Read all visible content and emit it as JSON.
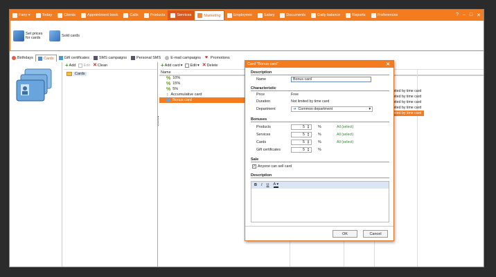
{
  "topbar": {
    "items": [
      {
        "label": "Fany ▾",
        "cls": ""
      },
      {
        "label": "Today",
        "cls": ""
      },
      {
        "label": "Clients",
        "cls": ""
      },
      {
        "label": "Appointment book",
        "cls": ""
      },
      {
        "label": "Calls",
        "cls": ""
      },
      {
        "label": "Products",
        "cls": ""
      },
      {
        "label": "Services",
        "cls": "sel"
      },
      {
        "label": "Marketing",
        "cls": "active"
      },
      {
        "label": "Employees",
        "cls": ""
      },
      {
        "label": "Salary",
        "cls": ""
      },
      {
        "label": "Documents",
        "cls": ""
      },
      {
        "label": "Daily balance",
        "cls": ""
      },
      {
        "label": "Reports",
        "cls": ""
      },
      {
        "label": "Preferences",
        "cls": ""
      }
    ],
    "win_controls": [
      "?",
      "–",
      "□",
      "✕"
    ]
  },
  "ribbon": {
    "set_prices": "Set prices for cards",
    "sold_cards": "Sold cards"
  },
  "tabs": [
    "Birthdays",
    "Cards",
    "Gift certificates",
    "SMS campaigns",
    "Personal SMS",
    "E-mail campaigns",
    "Promotions"
  ],
  "left_toolbar": {
    "add": "Add",
    "edit": "Edit",
    "clean": "Clean"
  },
  "tree": {
    "root": "Cards"
  },
  "right_toolbar": {
    "add_card": "Add card",
    "edit": "Edit",
    "delete": "Delete"
  },
  "list": {
    "header": "Name",
    "items": [
      "10%",
      "15%",
      "5%",
      "Accumulative card",
      "Bonus card"
    ]
  },
  "duration_cells": [
    "Not limited by time card",
    "Not limited by time card",
    "Not limited by time card",
    "Not limited by time card",
    "Not limited by time card"
  ],
  "dialog": {
    "title": "Card \"Bonus card\"",
    "description_section": "Description",
    "name_label": "Name",
    "name_value": "Bonus card",
    "characteristic_section": "Characteristic",
    "price_label": "Price",
    "price_value": "Free",
    "duration_label": "Duration",
    "duration_value": "Not limited by time card",
    "department_label": "Department",
    "department_value": "Common department",
    "bonuses_section": "Bonuses",
    "bonuses": [
      {
        "label": "Products",
        "value": "5",
        "unit": "%",
        "link": "All (select)"
      },
      {
        "label": "Services",
        "value": "5",
        "unit": "%",
        "link": "All (select)"
      },
      {
        "label": "Cards",
        "value": "5",
        "unit": "%",
        "link": "All (select)"
      },
      {
        "label": "Gift certificates",
        "value": "5",
        "unit": "%",
        "link": ""
      }
    ],
    "sale_section": "Sale",
    "anyone_can_sell": "Anyone can sell card",
    "description2_section": "Description",
    "editor_tools": [
      "B",
      "I",
      "U",
      "A ▾"
    ],
    "ok": "OK",
    "cancel": "Cancel"
  },
  "colors": {
    "accent": "#f47c20",
    "selection": "#f47c20",
    "link": "#2a8a2a"
  }
}
